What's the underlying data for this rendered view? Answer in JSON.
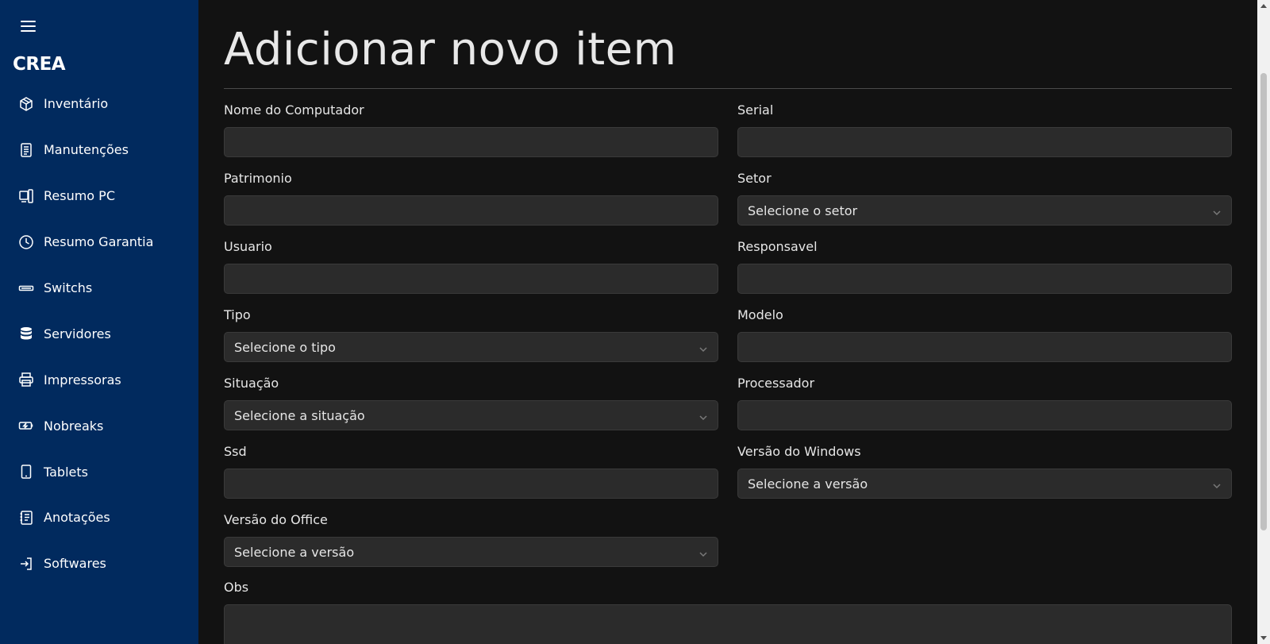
{
  "sidebar": {
    "brand": "CREA",
    "items": [
      {
        "label": "Inventário",
        "icon": "box-icon"
      },
      {
        "label": "Manutenções",
        "icon": "document-icon"
      },
      {
        "label": "Resumo PC",
        "icon": "devices-icon"
      },
      {
        "label": "Resumo Garantia",
        "icon": "clock-icon"
      },
      {
        "label": "Switchs",
        "icon": "switch-icon"
      },
      {
        "label": "Servidores",
        "icon": "database-icon"
      },
      {
        "label": "Impressoras",
        "icon": "printer-icon"
      },
      {
        "label": "Nobreaks",
        "icon": "battery-icon"
      },
      {
        "label": "Tablets",
        "icon": "tablet-icon"
      },
      {
        "label": "Anotações",
        "icon": "notebook-icon"
      },
      {
        "label": "Softwares",
        "icon": "login-icon"
      }
    ]
  },
  "main": {
    "title": "Adicionar novo item",
    "fields": {
      "nome_computador": {
        "label": "Nome do Computador",
        "value": ""
      },
      "serial": {
        "label": "Serial",
        "value": ""
      },
      "patrimonio": {
        "label": "Patrimonio",
        "value": ""
      },
      "setor": {
        "label": "Setor",
        "selected": "Selecione o setor"
      },
      "usuario": {
        "label": "Usuario",
        "value": ""
      },
      "responsavel": {
        "label": "Responsavel",
        "value": ""
      },
      "tipo": {
        "label": "Tipo",
        "selected": "Selecione o tipo"
      },
      "modelo": {
        "label": "Modelo",
        "value": ""
      },
      "situacao": {
        "label": "Situação",
        "selected": "Selecione a situação"
      },
      "processador": {
        "label": "Processador",
        "value": ""
      },
      "ssd": {
        "label": "Ssd",
        "value": ""
      },
      "versao_windows": {
        "label": "Versão do Windows",
        "selected": "Selecione a versão"
      },
      "versao_office": {
        "label": "Versão do Office",
        "selected": "Selecione a versão"
      },
      "obs": {
        "label": "Obs",
        "value": ""
      }
    }
  },
  "colors": {
    "sidebar_bg": "#012a5e",
    "main_bg": "#121212",
    "input_bg": "#2b2b2b"
  }
}
